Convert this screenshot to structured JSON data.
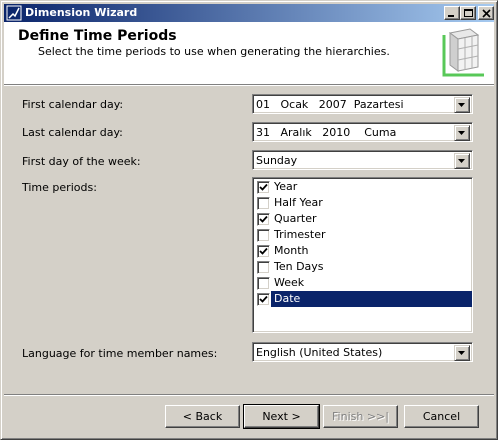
{
  "window": {
    "title": "Dimension Wizard"
  },
  "header": {
    "title": "Define Time Periods",
    "subtitle": "Select the time periods to use when generating the hierarchies."
  },
  "form": {
    "first_calendar_day": {
      "label": "First calendar day:",
      "value": "01   Ocak   2007  Pazartesi"
    },
    "last_calendar_day": {
      "label": "Last calendar day:",
      "value": "31   Aralık   2010    Cuma"
    },
    "first_day_of_week": {
      "label": "First day of the week:",
      "value": "Sunday"
    },
    "time_periods": {
      "label": "Time periods:",
      "items": [
        {
          "label": "Year",
          "checked": true,
          "selected": false
        },
        {
          "label": "Half Year",
          "checked": false,
          "selected": false
        },
        {
          "label": "Quarter",
          "checked": true,
          "selected": false
        },
        {
          "label": "Trimester",
          "checked": false,
          "selected": false
        },
        {
          "label": "Month",
          "checked": true,
          "selected": false
        },
        {
          "label": "Ten Days",
          "checked": false,
          "selected": false
        },
        {
          "label": "Week",
          "checked": false,
          "selected": false
        },
        {
          "label": "Date",
          "checked": true,
          "selected": true
        }
      ]
    },
    "language": {
      "label": "Language for time member names:",
      "value": "English (United States)"
    }
  },
  "buttons": {
    "back": "< Back",
    "next": "Next >",
    "finish": "Finish >>|",
    "cancel": "Cancel"
  },
  "colors": {
    "title_gradient_start": "#0a246a",
    "title_gradient_end": "#a6caf0",
    "selection": "#0a246a",
    "dialog_face": "#d4d0c8",
    "graphic_accent": "#58c858"
  }
}
